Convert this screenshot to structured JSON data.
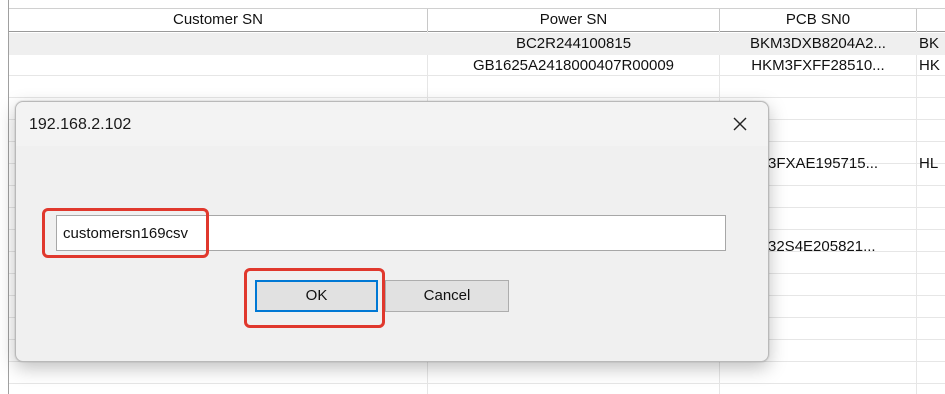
{
  "table": {
    "columns": [
      "Customer SN",
      "Power SN",
      "PCB SN0",
      ""
    ],
    "rows": [
      {
        "customer_sn": "",
        "power_sn": "BC2R244100815",
        "pcb_sn0": "BKM3DXB8204A2...",
        "extra": "BK",
        "selected": true
      },
      {
        "customer_sn": "",
        "power_sn": "GB1625A2418000407R00009",
        "pcb_sn0": "HKM3FXFF28510...",
        "extra": "HK",
        "selected": false
      }
    ],
    "partial_rows": [
      {
        "pcb_sn0": "3FXAE195715...",
        "extra": "HL"
      },
      {
        "pcb_sn0": "32S4E205821...",
        "extra": ""
      }
    ]
  },
  "dialog": {
    "title": "192.168.2.102",
    "close_glyph": "✕",
    "input_value": "customersn169csv",
    "ok_label": "OK",
    "cancel_label": "Cancel"
  },
  "colors": {
    "highlight": "#e0382d",
    "focus": "#0078d4"
  }
}
